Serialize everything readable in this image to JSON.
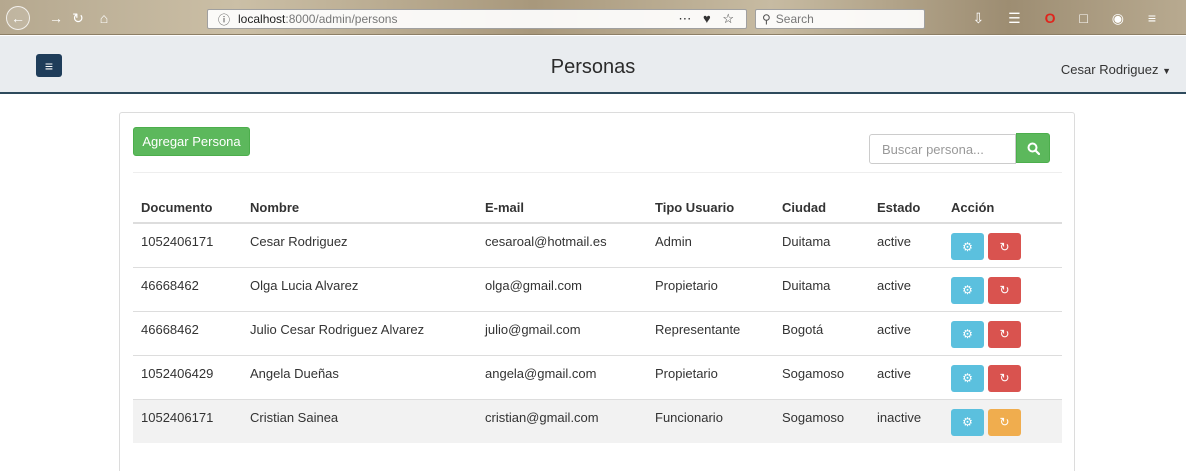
{
  "browser": {
    "url_host": "localhost",
    "url_path": ":8000/admin/persons",
    "search_placeholder": "Search"
  },
  "header": {
    "title": "Personas",
    "user": "Cesar Rodriguez"
  },
  "toolbar": {
    "add_label": "Agregar Persona",
    "search_placeholder": "Buscar persona..."
  },
  "table": {
    "columns": [
      "Documento",
      "Nombre",
      "E-mail",
      "Tipo Usuario",
      "Ciudad",
      "Estado",
      "Acción"
    ],
    "rows": [
      {
        "documento": "1052406171",
        "nombre": "Cesar Rodriguez",
        "email": "cesaroal@hotmail.es",
        "tipo": "Admin",
        "ciudad": "Duitama",
        "estado": "active"
      },
      {
        "documento": "46668462",
        "nombre": "Olga Lucia Alvarez",
        "email": "olga@gmail.com",
        "tipo": "Propietario",
        "ciudad": "Duitama",
        "estado": "active"
      },
      {
        "documento": "46668462",
        "nombre": "Julio Cesar Rodriguez Alvarez",
        "email": "julio@gmail.com",
        "tipo": "Representante",
        "ciudad": "Bogotá",
        "estado": "active"
      },
      {
        "documento": "1052406429",
        "nombre": "Angela Dueñas",
        "email": "angela@gmail.com",
        "tipo": "Propietario",
        "ciudad": "Sogamoso",
        "estado": "active"
      },
      {
        "documento": "1052406171",
        "nombre": "Cristian Sainea",
        "email": "cristian@gmail.com",
        "tipo": "Funcionario",
        "ciudad": "Sogamoso",
        "estado": "inactive"
      }
    ]
  },
  "colors": {
    "success": "#5cb85c",
    "info": "#5bc0de",
    "danger": "#d9534f",
    "warning": "#f0ad4e",
    "nav_dark": "#1f3d5a"
  }
}
